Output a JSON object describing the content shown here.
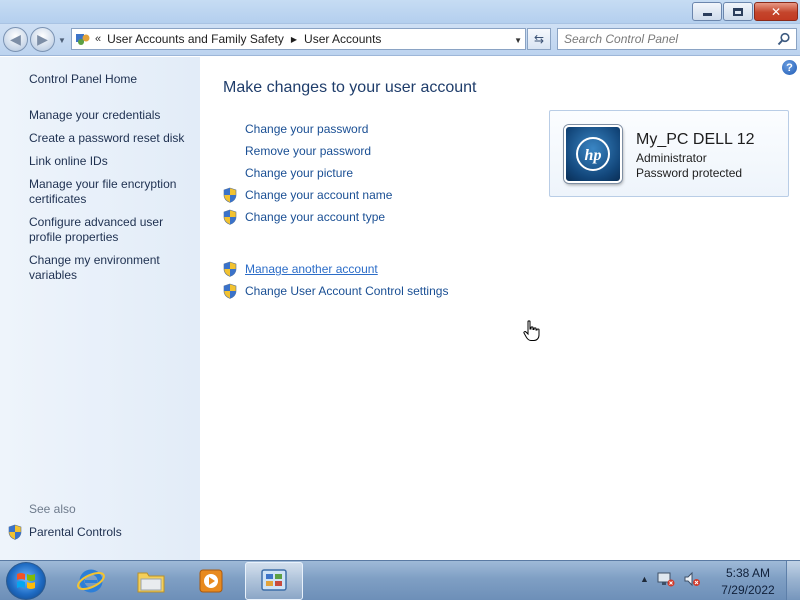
{
  "window": {
    "minimize_icon": "minimize-icon",
    "maximize_icon": "restore-icon",
    "close_icon": "close-icon"
  },
  "address": {
    "overflow": "«",
    "breadcrumbs": [
      "User Accounts and Family Safety",
      "User Accounts"
    ],
    "search_placeholder": "Search Control Panel"
  },
  "sidebar": {
    "home": "Control Panel Home",
    "items": [
      "Manage your credentials",
      "Create a password reset disk",
      "Link online IDs",
      "Manage your file encryption certificates",
      "Configure advanced user profile properties",
      "Change my environment variables"
    ],
    "see_also": "See also",
    "parental_controls": "Parental Controls"
  },
  "main": {
    "heading": "Make changes to your user account",
    "links": [
      "Change your password",
      "Remove your password",
      "Change your picture",
      "Change your account name",
      "Change your account type"
    ],
    "links2": [
      "Manage another account",
      "Change User Account Control settings"
    ]
  },
  "account": {
    "name": "My_PC DELL 12",
    "role": "Administrator",
    "status": "Password protected",
    "picture_logo": "hp"
  },
  "taskbar": {
    "time": "5:38 AM",
    "date": "7/29/2022"
  },
  "colors": {
    "link": "#1a4f94",
    "heading": "#1f3d6b",
    "sidebar_bg": "#e6eef9",
    "taskbar": "#7f9fc4"
  }
}
